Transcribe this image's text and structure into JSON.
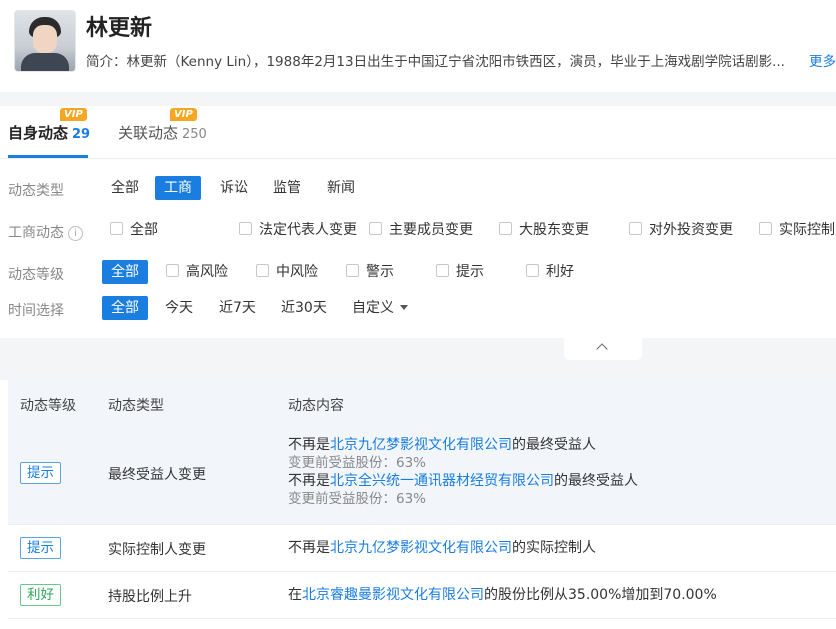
{
  "profile": {
    "name": "林更新",
    "intro_label": "简介：",
    "intro_text": "林更新（Kenny Lin），1988年2月13日出生于中国辽宁省沈阳市铁西区，演员，毕业于上海戏剧学院话剧影...",
    "more_label": "更多"
  },
  "tabs": [
    {
      "label": "自身动态",
      "count": "29",
      "vip": "VIP"
    },
    {
      "label": "关联动态",
      "count": "250",
      "vip": "VIP"
    }
  ],
  "filters": {
    "type": {
      "label": "动态类型",
      "options": [
        "全部",
        "工商",
        "诉讼",
        "监管",
        "新闻"
      ],
      "selected": "工商"
    },
    "biz": {
      "label": "工商动态",
      "info_icon": "i",
      "options": [
        "全部",
        "法定代表人变更",
        "主要成员变更",
        "大股东变更",
        "对外投资变更",
        "实际控制人"
      ]
    },
    "level": {
      "label": "动态等级",
      "options": [
        "全部",
        "高风险",
        "中风险",
        "警示",
        "提示",
        "利好"
      ],
      "selected": "全部"
    },
    "time": {
      "label": "时间选择",
      "options": [
        "全部",
        "今天",
        "近7天",
        "近30天",
        "自定义"
      ],
      "selected": "全部"
    }
  },
  "table": {
    "headers": [
      "动态等级",
      "动态类型",
      "动态内容"
    ],
    "rows": [
      {
        "level": "提示",
        "type": "最终受益人变更",
        "lines": [
          {
            "pre": "不再是",
            "link": "北京九亿梦影视文化有限公司",
            "post": "的最终受益人"
          },
          {
            "sub": "变更前受益股份：63%"
          },
          {
            "pre": "不再是",
            "link": "北京全兴统一通讯器材经贸有限公司",
            "post": "的最终受益人"
          },
          {
            "sub": "变更前受益股份：63%"
          }
        ]
      },
      {
        "level": "提示",
        "type": "实际控制人变更",
        "lines": [
          {
            "pre": "不再是",
            "link": "北京九亿梦影视文化有限公司",
            "post": "的实际控制人"
          }
        ]
      },
      {
        "level": "利好",
        "type": "持股比例上升",
        "lines": [
          {
            "pre": "在",
            "link": "北京睿趣曼影视文化有限公司",
            "post": "的股份比例从35.00%增加到70.00%"
          }
        ]
      }
    ]
  }
}
